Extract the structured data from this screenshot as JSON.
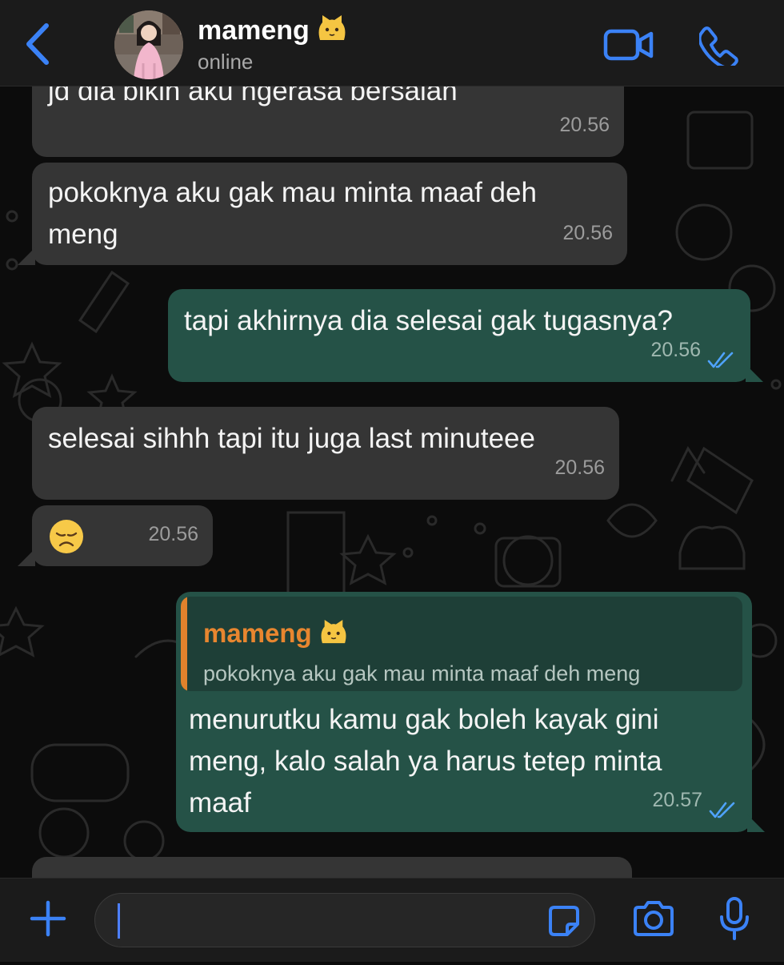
{
  "header": {
    "back_icon": "chevron-left-icon",
    "contact_name": "mameng",
    "contact_emoji": "cat-face-emoji",
    "status": "online",
    "video_icon": "video-camera-icon",
    "call_icon": "phone-icon",
    "accent": "#3b82f6"
  },
  "messages": [
    {
      "dir": "in",
      "lines": [
        "jd dia bikin aku ngerasa bersalah"
      ],
      "time": "20.56"
    },
    {
      "dir": "in",
      "lines": [
        "pokoknya aku gak mau minta maaf deh",
        "meng"
      ],
      "time": "20.56"
    },
    {
      "dir": "out",
      "lines": [
        "tapi akhirnya dia selesai gak tugasnya?"
      ],
      "time": "20.56",
      "read": true
    },
    {
      "dir": "in",
      "lines": [
        "selesai sihhh tapi itu juga last minuteee"
      ],
      "time": "20.56"
    },
    {
      "dir": "in",
      "emoji": "disappointed-face-emoji",
      "time": "20.56"
    },
    {
      "dir": "out",
      "quote": {
        "name": "mameng",
        "text": "pokoknya aku gak mau minta maaf deh meng"
      },
      "lines": [
        "menurutku kamu gak boleh kayak gini",
        "meng, kalo salah ya harus tetep minta",
        "maaf"
      ],
      "time": "20.57",
      "read": true
    }
  ],
  "colors": {
    "incoming_bubble": "#353535",
    "outgoing_bubble": "#255247",
    "quote_name": "#e8862f",
    "read_ticks": "#4fa3ff"
  },
  "input": {
    "plus_icon": "plus-icon",
    "sticker_icon": "sticker-icon",
    "camera_icon": "camera-icon",
    "mic_icon": "microphone-icon",
    "value": ""
  }
}
